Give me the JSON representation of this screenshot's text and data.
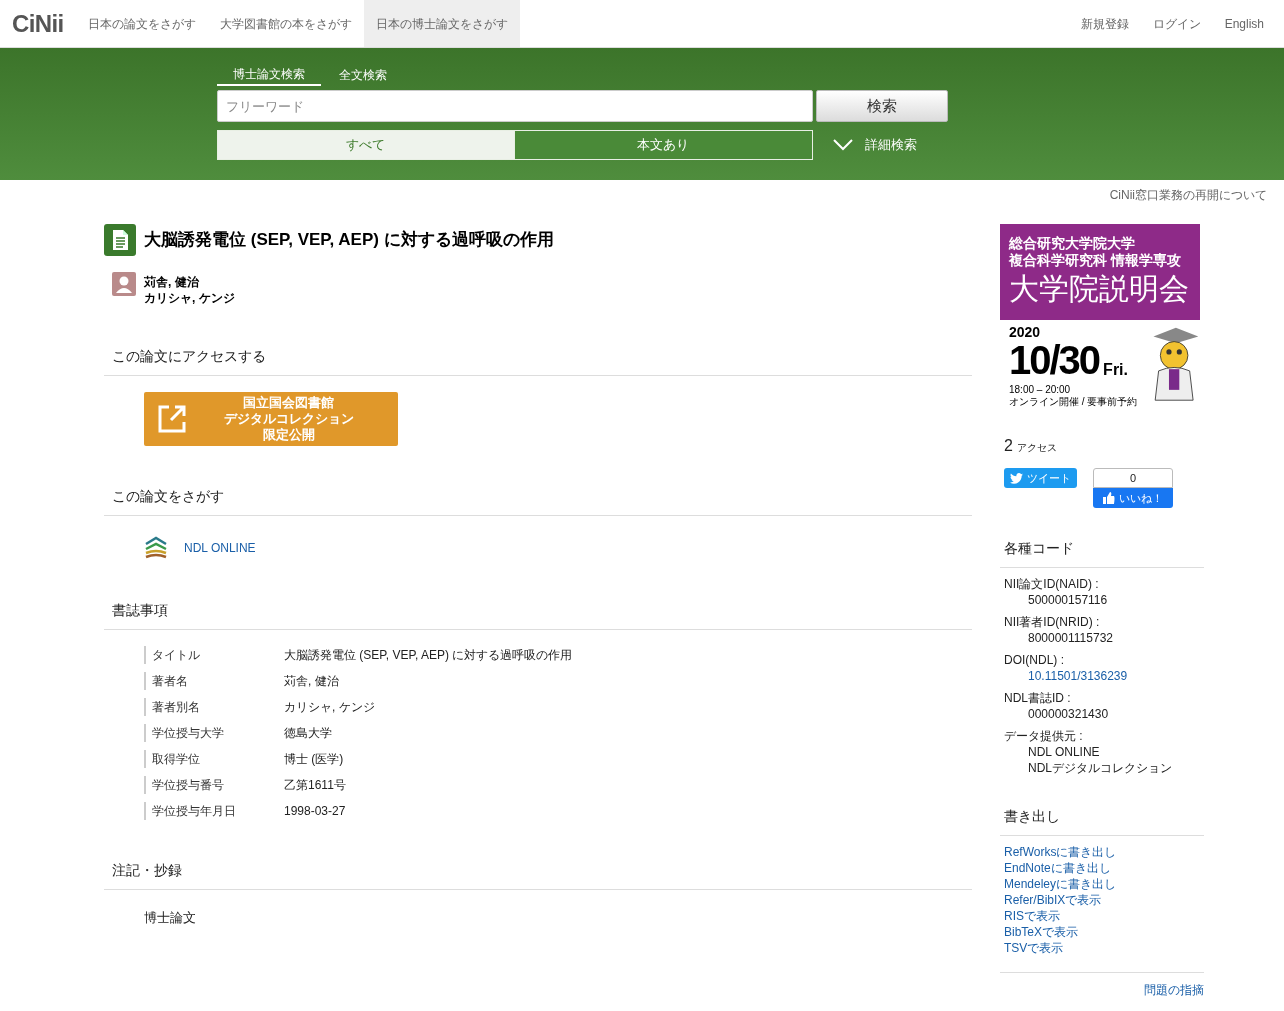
{
  "nav": {
    "logo": "CiNii",
    "links": [
      {
        "label": "日本の論文をさがす",
        "selected": false
      },
      {
        "label": "大学図書館の本をさがす",
        "selected": false
      },
      {
        "label": "日本の博士論文をさがす",
        "selected": true
      }
    ],
    "right_links": [
      "新規登録",
      "ログイン",
      "English"
    ]
  },
  "search": {
    "tabs": [
      {
        "label": "博士論文検索",
        "selected": true
      },
      {
        "label": "全文検索",
        "selected": false
      }
    ],
    "placeholder": "フリーワード",
    "button": "検索",
    "filters": [
      {
        "label": "すべて",
        "selected": true
      },
      {
        "label": "本文あり",
        "selected": false
      }
    ],
    "advanced": "詳細検索"
  },
  "notice": "CiNii窓口業務の再開について",
  "article": {
    "title": "大脳誘発電位 (SEP, VEP, AEP) に対する過呼吸の作用",
    "author": {
      "name": "苅舎, 健治",
      "kana": "カリシャ, ケンジ"
    },
    "access": {
      "heading": "この論文にアクセスする",
      "button": [
        "国立国会図書館",
        "デジタルコレクション",
        "限定公開"
      ]
    },
    "find": {
      "heading": "この論文をさがす",
      "link": "NDL ONLINE"
    },
    "biblio": {
      "heading": "書誌事項",
      "rows": [
        {
          "label": "タイトル",
          "value": "大脳誘発電位 (SEP, VEP, AEP) に対する過呼吸の作用"
        },
        {
          "label": "著者名",
          "value": "苅舎, 健治"
        },
        {
          "label": "著者別名",
          "value": "カリシャ, ケンジ"
        },
        {
          "label": "学位授与大学",
          "value": "徳島大学"
        },
        {
          "label": "取得学位",
          "value": "博士 (医学)"
        },
        {
          "label": "学位授与番号",
          "value": "乙第1611号"
        },
        {
          "label": "学位授与年月日",
          "value": "1998-03-27"
        }
      ]
    },
    "notes": {
      "heading": "注記・抄録",
      "text": "博士論文"
    }
  },
  "sidebar": {
    "banner": {
      "lines": [
        "総合研究大学院大学",
        "複合科学研究科 情報学専攻"
      ],
      "headline": "大学院説明会",
      "year": "2020",
      "date": "10/30",
      "weekday": "Fri.",
      "time": "18:00 – 20:00",
      "note": "オンライン開催 / 要事前予約"
    },
    "access_count": "2",
    "access_label": "アクセス",
    "tweet": "ツイート",
    "like_count": "0",
    "like": "いいね！",
    "codes": {
      "heading": "各種コード",
      "items": [
        {
          "label": "NII論文ID(NAID) :",
          "values": [
            {
              "text": "500000157116",
              "link": false
            }
          ]
        },
        {
          "label": "NII著者ID(NRID) :",
          "values": [
            {
              "text": "8000001115732",
              "link": false
            }
          ]
        },
        {
          "label": "DOI(NDL) :",
          "values": [
            {
              "text": "10.11501/3136239",
              "link": true
            }
          ]
        },
        {
          "label": "NDL書誌ID :",
          "values": [
            {
              "text": "000000321430",
              "link": false
            }
          ]
        },
        {
          "label": "データ提供元 :",
          "values": [
            {
              "text": "NDL ONLINE",
              "link": false
            },
            {
              "text": "NDLデジタルコレクション",
              "link": false
            }
          ]
        }
      ]
    },
    "export": {
      "heading": "書き出し",
      "links": [
        "RefWorksに書き出し",
        "EndNoteに書き出し",
        "Mendeleyに書き出し",
        "Refer/BibIXで表示",
        "RISで表示",
        "BibTeXで表示",
        "TSVで表示"
      ]
    },
    "report": "問題の指摘"
  }
}
